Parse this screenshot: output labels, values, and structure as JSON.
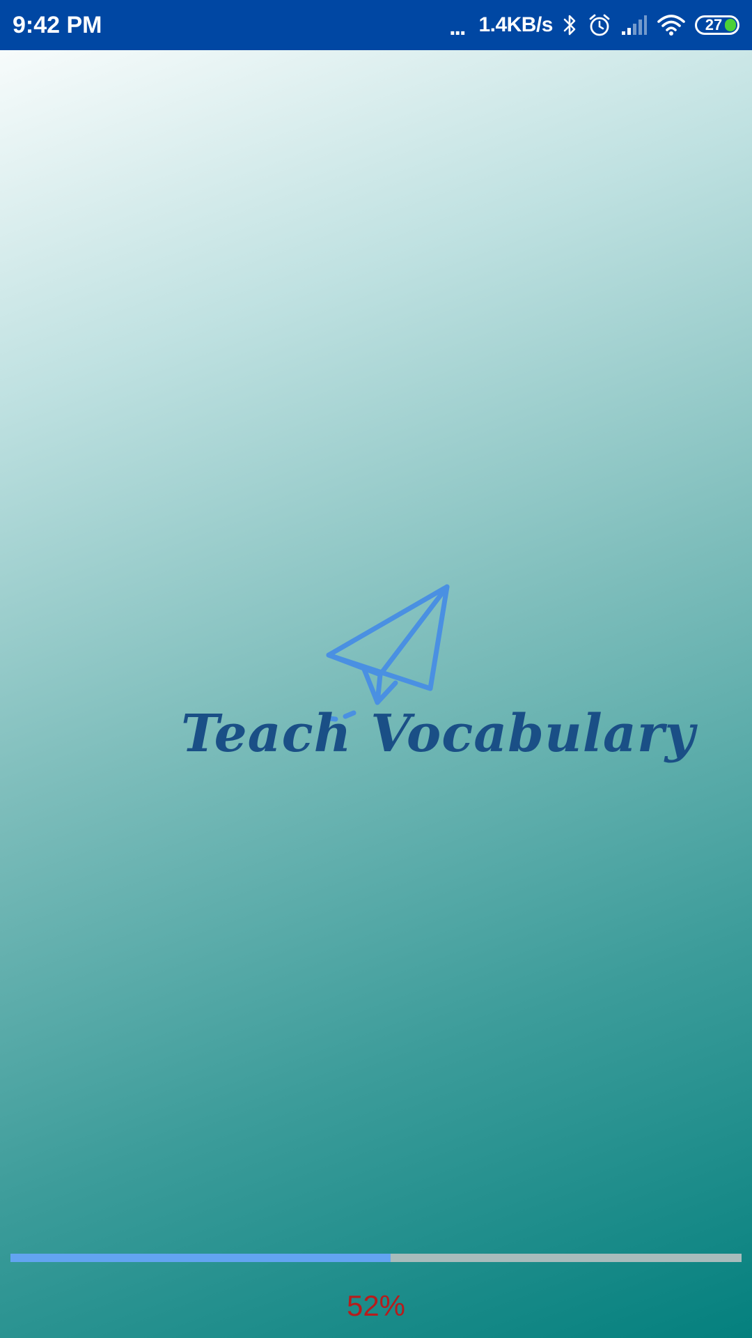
{
  "status_bar": {
    "time": "9:42 PM",
    "dots": "...",
    "net_speed": "1.4KB/s",
    "battery_level": "27",
    "icons": [
      "bluetooth-icon",
      "alarm-icon",
      "signal-icon",
      "wifi-icon",
      "battery-icon"
    ],
    "background_color": "#0047a3"
  },
  "splash": {
    "app_name": "Teach Vocabulary",
    "logo_icon": "paper-plane-icon",
    "logo_text_color": "#1a4f86",
    "logo_icon_color": "#4a90e2"
  },
  "loading": {
    "progress_percent": 52,
    "progress_label": "52%",
    "fill_color": "#63a4f1",
    "track_color": "#a8bcbc",
    "label_color": "#b71c1c"
  }
}
